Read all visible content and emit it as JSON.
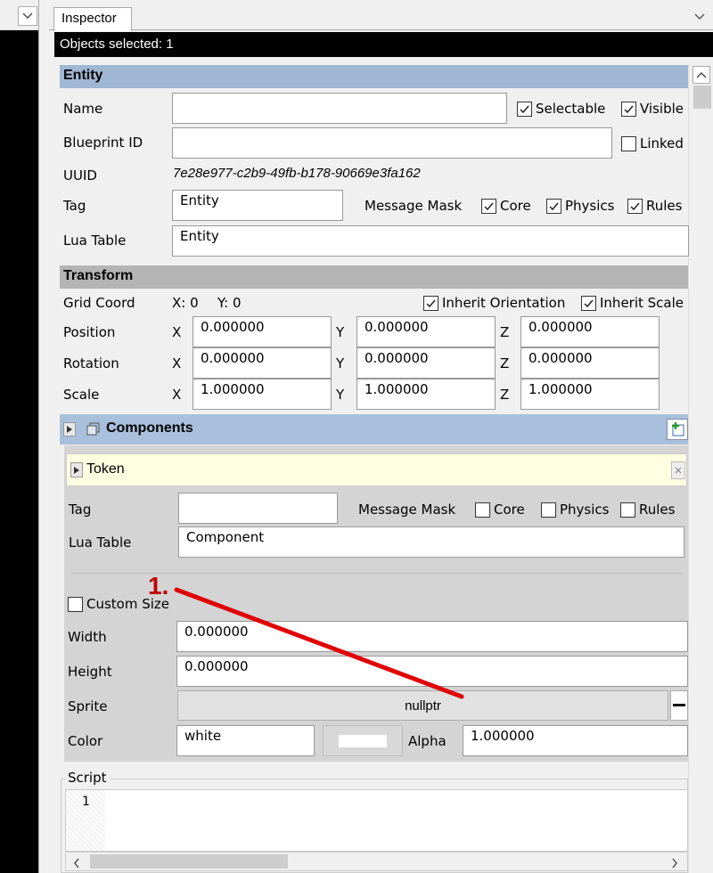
{
  "tab_label": "Inspector",
  "objects_selected": "Objects selected: 1",
  "entity": {
    "header": "Entity",
    "name_label": "Name",
    "name_value": "",
    "selectable_label": "Selectable",
    "selectable_checked": true,
    "visible_label": "Visible",
    "visible_checked": true,
    "blueprint_label": "Blueprint ID",
    "blueprint_value": "",
    "linked_label": "Linked",
    "linked_checked": false,
    "uuid_label": "UUID",
    "uuid_value": "7e28e977-c2b9-49fb-b178-90669e3fa162",
    "tag_label": "Tag",
    "tag_value": "Entity",
    "message_mask_label": "Message Mask",
    "core_label": "Core",
    "physics_label": "Physics",
    "rules_label": "Rules",
    "lua_table_label": "Lua Table",
    "lua_table_value": "Entity"
  },
  "transform": {
    "header": "Transform",
    "grid_coord_label": "Grid Coord",
    "grid_x": "X: 0",
    "grid_y": "Y: 0",
    "inherit_orientation_label": "Inherit Orientation",
    "inherit_scale_label": "Inherit Scale",
    "axis_x": "X",
    "axis_y": "Y",
    "axis_z": "Z",
    "position_label": "Position",
    "position": [
      "0.000000",
      "0.000000",
      "0.000000"
    ],
    "rotation_label": "Rotation",
    "rotation": [
      "0.000000",
      "0.000000",
      "0.000000"
    ],
    "scale_label": "Scale",
    "scale": [
      "1.000000",
      "1.000000",
      "1.000000"
    ]
  },
  "components": {
    "header": "Components",
    "token_label": "Token",
    "tag_label": "Tag",
    "tag_value": "",
    "message_mask_label": "Message Mask",
    "core_label": "Core",
    "physics_label": "Physics",
    "rules_label": "Rules",
    "lua_table_label": "Lua Table",
    "lua_table_value": "Component",
    "custom_size_label": "Custom Size",
    "width_label": "Width",
    "width_value": "0.000000",
    "height_label": "Height",
    "height_value": "0.000000",
    "sprite_label": "Sprite",
    "sprite_value": "nullptr",
    "color_label": "Color",
    "color_value": "white",
    "alpha_label": "Alpha",
    "alpha_value": "1.000000",
    "script_label": "Script",
    "script_line_number": "1"
  },
  "annotation": {
    "label": "1.",
    "color": "#e00000"
  },
  "colors": {
    "entity_header": "#9fb7d3",
    "transform_header": "#b4b4b4",
    "components_header": "#a8c0dc",
    "token_bg": "#ffffe1"
  }
}
